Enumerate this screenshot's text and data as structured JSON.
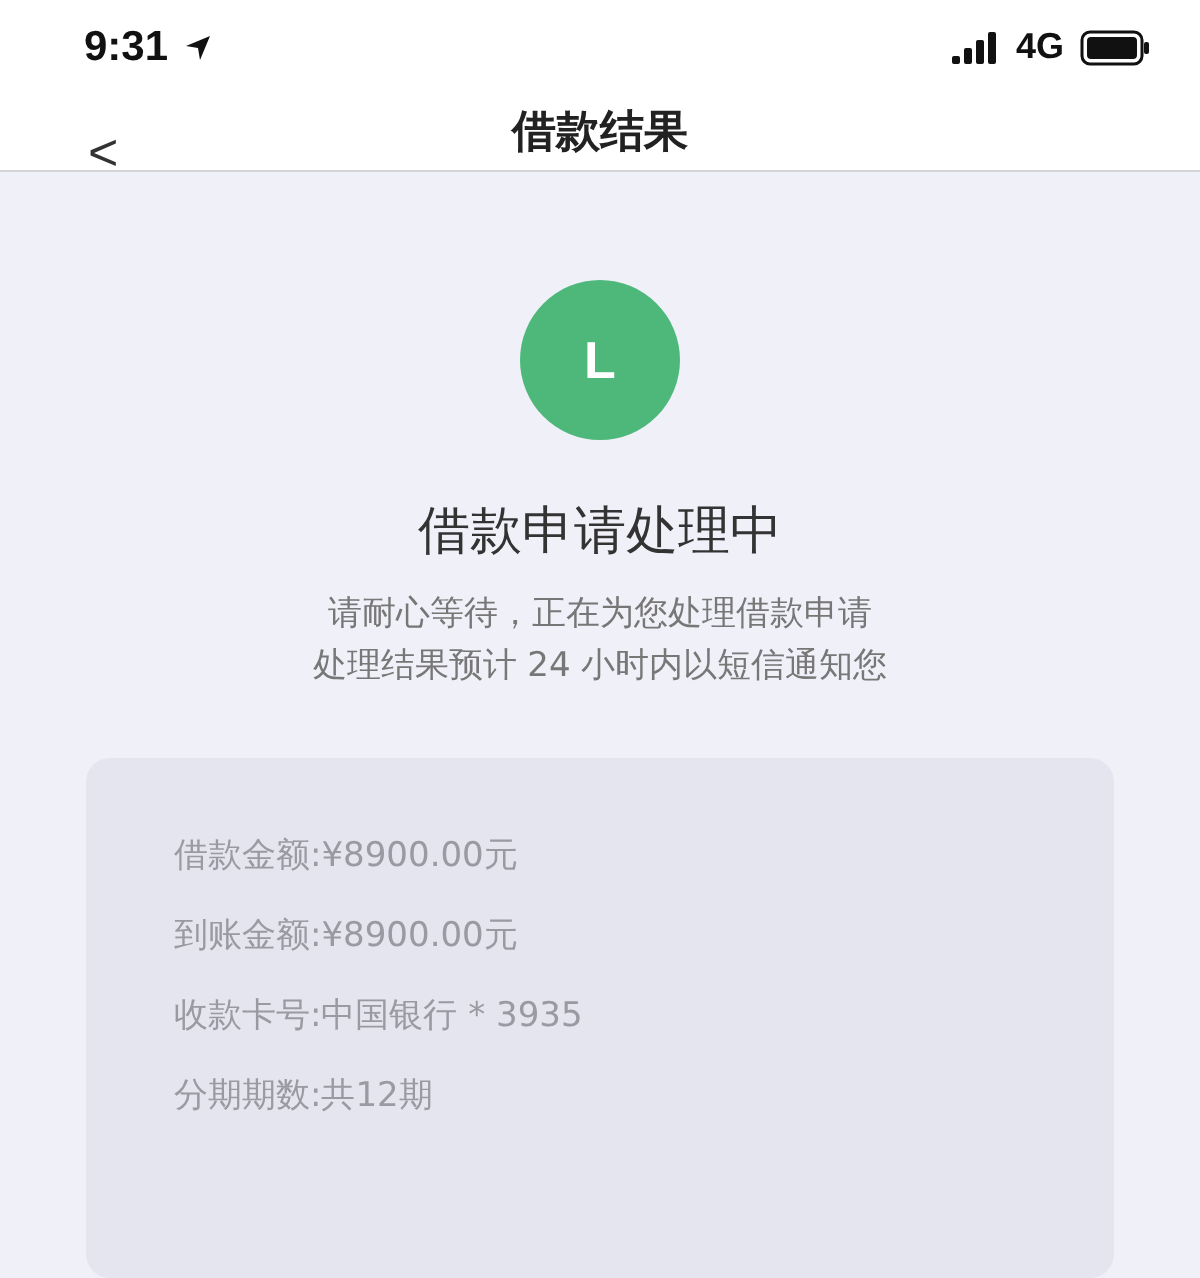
{
  "status_bar": {
    "time": "9:31",
    "network": "4G"
  },
  "nav": {
    "back": "<",
    "title": "借款结果"
  },
  "status": {
    "icon_letter": "L",
    "title": "借款申请处理中",
    "lines": [
      "请耐心等待，正在为您处理借款申请",
      "处理结果预计 24 小时内以短信通知您"
    ]
  },
  "details": [
    {
      "label": "借款金额:",
      "value": "¥8900.00元"
    },
    {
      "label": "到账金额:",
      "value": "¥8900.00元"
    },
    {
      "label": "收款卡号:",
      "value": "中国银行 * 3935"
    },
    {
      "label": "分期期数:",
      "value": "共12期"
    }
  ]
}
